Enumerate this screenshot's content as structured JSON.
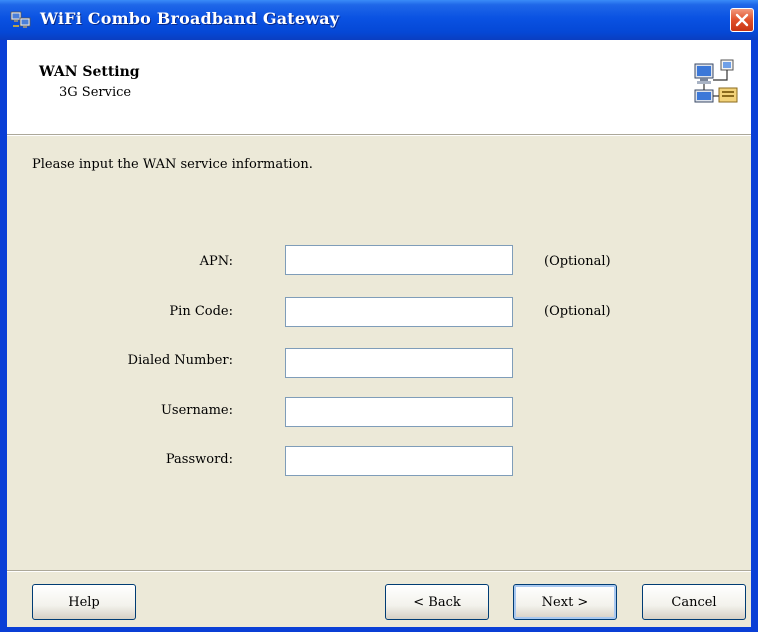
{
  "window": {
    "title": "WiFi Combo Broadband Gateway",
    "title_bar_color": "#0548D6",
    "close_button_color": "#E0502A"
  },
  "header": {
    "title": "WAN Setting",
    "subtitle": "3G Service",
    "icon": "network-computers-icon"
  },
  "form": {
    "instruction": "Please input the WAN service information.",
    "fields": {
      "apn": {
        "label": "APN:",
        "value": "",
        "note": "(Optional)"
      },
      "pin_code": {
        "label": "Pin Code:",
        "value": "",
        "note": "(Optional)"
      },
      "dialed_number": {
        "label": "Dialed Number:",
        "value": ""
      },
      "username": {
        "label": "Username:",
        "value": ""
      },
      "password": {
        "label": "Password:",
        "value": ""
      }
    }
  },
  "buttons": {
    "help": "Help",
    "back": "< Back",
    "next": "Next >",
    "cancel": "Cancel"
  }
}
